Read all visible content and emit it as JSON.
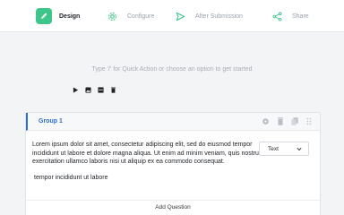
{
  "nav": {
    "tabs": [
      {
        "label": "Design",
        "icon": "pencil-icon",
        "active": true
      },
      {
        "label": "Configure",
        "icon": "gear-icon",
        "active": false
      },
      {
        "label": "After Submission",
        "icon": "send-icon",
        "active": false
      },
      {
        "label": "Share",
        "icon": "share-icon",
        "active": false
      }
    ],
    "active_color": "#3cc68a",
    "inactive_color": "#9aa3ad"
  },
  "canvas": {
    "hint": "Type '/' for Quick Action or choose an option to get started",
    "media_icons": [
      "video-icon",
      "image-icon",
      "layout-icon",
      "trash-icon"
    ]
  },
  "group": {
    "title": "Group 1",
    "accent_color": "#2e6bd6",
    "actions": [
      "gear-icon",
      "trash-icon",
      "duplicate-icon",
      "drag-handle-icon"
    ],
    "question": {
      "text": "Lorem ipsum dolor sit amet, consectetur adipiscing elit, sed do eiusmod tempor incididunt ut labore et dolore magna aliqua. Ut enim ad minim veniam, quis nostrud exercitation ullamco laboris nisi ut aliquip ex ea commodo consequat.",
      "subtext": "tempor incididunt ut labore",
      "type": "Text"
    },
    "add_question_label": "Add Question"
  }
}
